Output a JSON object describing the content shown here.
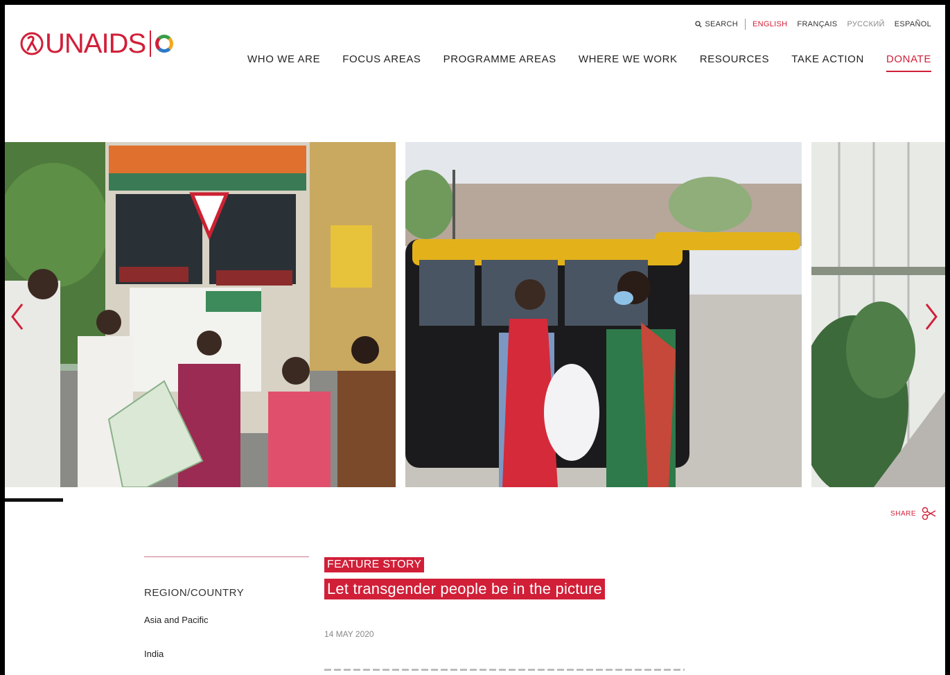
{
  "brand": {
    "name": "UNAIDS",
    "accent": "#d11f38"
  },
  "utility": {
    "search_label": "SEARCH",
    "languages": [
      "ENGLISH",
      "FRANÇAIS",
      "РУССКИЙ",
      "ESPAÑOL"
    ],
    "active_language": "ENGLISH"
  },
  "nav": {
    "items": [
      "WHO WE ARE",
      "FOCUS AREAS",
      "PROGRAMME AREAS",
      "WHERE WE WORK",
      "RESOURCES",
      "TAKE ACTION",
      "DONATE"
    ]
  },
  "carousel": {
    "prev_icon": "chevron-left-icon",
    "next_icon": "chevron-right-icon",
    "slides": [
      "slide-relief-truck",
      "slide-taxi-handover",
      "slide-partial"
    ]
  },
  "share": {
    "label": "SHARE",
    "icon": "scissors-share-icon"
  },
  "sidebar": {
    "heading": "REGION/COUNTRY",
    "items": [
      "Asia and Pacific",
      "India"
    ]
  },
  "article": {
    "tag": "FEATURE STORY",
    "title": "Let transgender people be in the picture",
    "date": "14 MAY 2020"
  }
}
